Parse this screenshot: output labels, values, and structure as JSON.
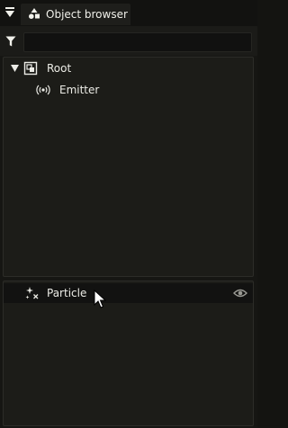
{
  "panel": {
    "collapse_icon": "triangle-down-icon",
    "tab_title": "Object browser",
    "tab_icon": "shapes-icon"
  },
  "filter": {
    "icon": "filter-icon",
    "value": "",
    "placeholder": ""
  },
  "tree": {
    "items": [
      {
        "label": "Root",
        "icon": "group-icon",
        "expanded": true
      },
      {
        "label": "Emitter",
        "icon": "emitter-icon"
      }
    ]
  },
  "components": {
    "items": [
      {
        "label": "Particle",
        "icon": "particle-icon",
        "visibility_icon": "eye-icon"
      }
    ]
  },
  "colors": {
    "background": "#161613",
    "panel": "#1c1c18",
    "text": "#ecece6",
    "selected_row": "#121211"
  }
}
